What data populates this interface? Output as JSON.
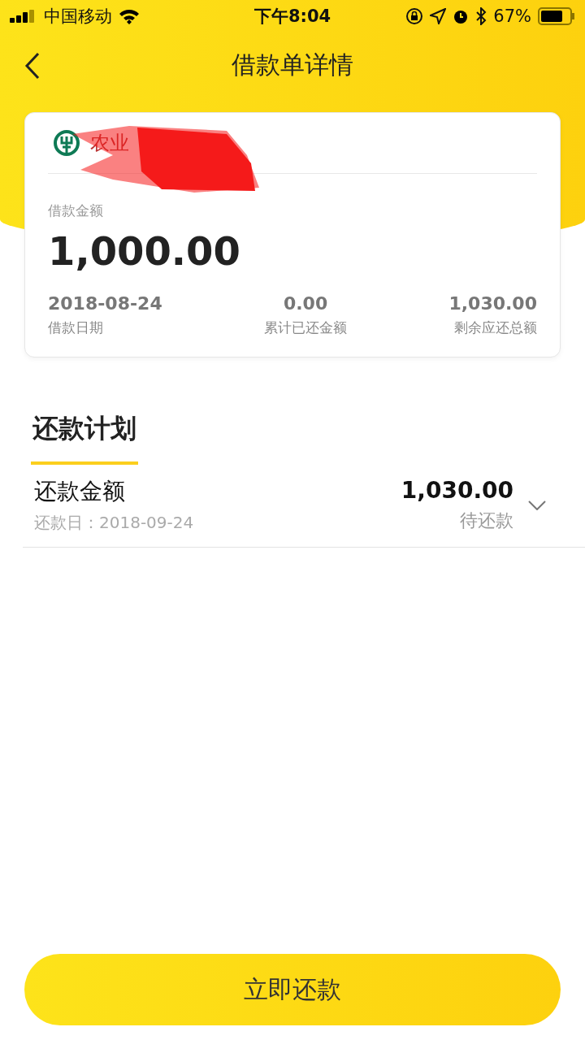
{
  "status_bar": {
    "carrier": "中国移动",
    "time": "下午8:04",
    "battery": "67%"
  },
  "nav": {
    "title": "借款单详情"
  },
  "loan_card": {
    "bank": "农业",
    "amount_label": "借款金额",
    "amount": "1,000.00",
    "stats": [
      {
        "value": "2018-08-24",
        "label": "借款日期"
      },
      {
        "value": "0.00",
        "label": "累计已还金额"
      },
      {
        "value": "1,030.00",
        "label": "剩余应还总额"
      }
    ]
  },
  "plan": {
    "tabs": [
      {
        "label": "还款计划",
        "selected": true
      }
    ],
    "rows": [
      {
        "title": "还款金额",
        "date": "还款日：2018-09-24",
        "amount": "1,030.00",
        "status": "待还款",
        "expanded": false
      }
    ]
  },
  "action": {
    "label": "立即还款"
  }
}
